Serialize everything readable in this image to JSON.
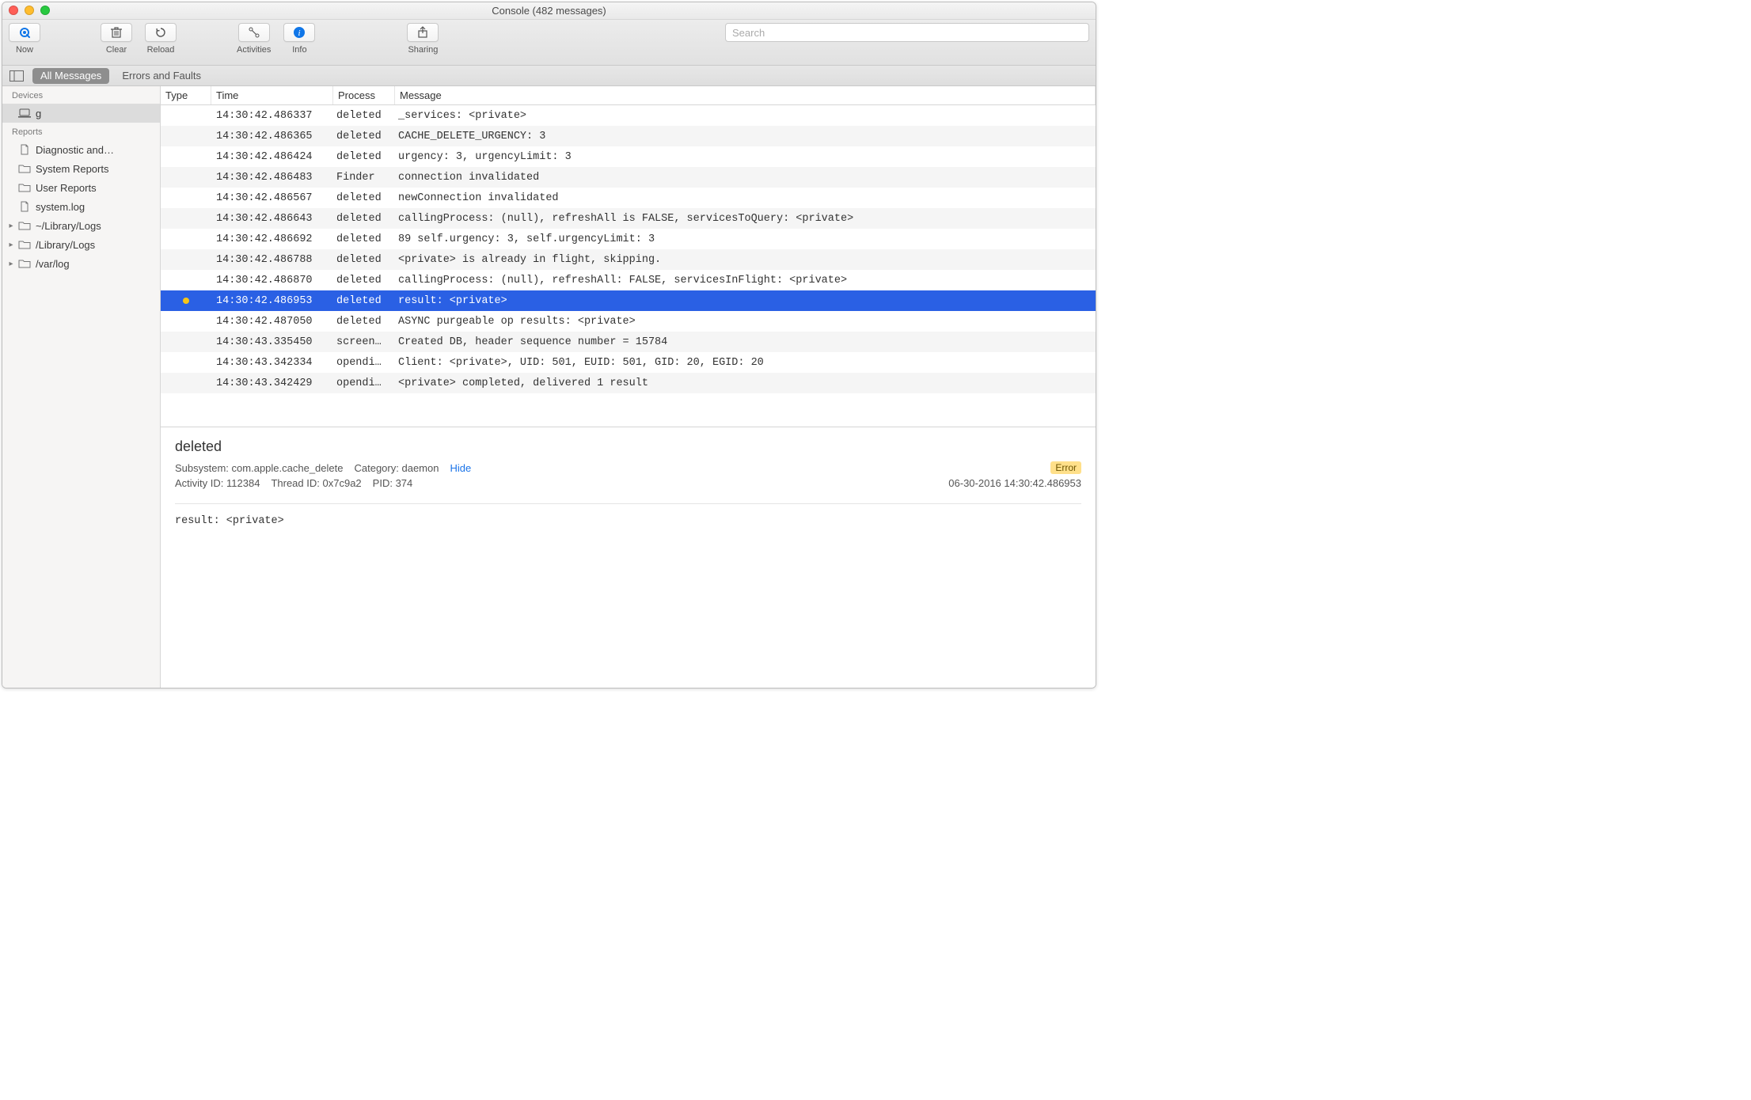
{
  "window": {
    "title": "Console (482 messages)"
  },
  "toolbar": {
    "now": "Now",
    "clear": "Clear",
    "reload": "Reload",
    "activities": "Activities",
    "info": "Info",
    "sharing": "Sharing",
    "search_placeholder": "Search"
  },
  "filterbar": {
    "all_messages": "All Messages",
    "errors_faults": "Errors and Faults"
  },
  "sidebar": {
    "devices_header": "Devices",
    "device_name": "g",
    "reports_header": "Reports",
    "reports": [
      {
        "label": "Diagnostic and…",
        "icon": "file",
        "disclosure": false
      },
      {
        "label": "System Reports",
        "icon": "folder",
        "disclosure": false
      },
      {
        "label": "User Reports",
        "icon": "folder",
        "disclosure": false
      },
      {
        "label": "system.log",
        "icon": "file",
        "disclosure": false
      },
      {
        "label": "~/Library/Logs",
        "icon": "folder",
        "disclosure": true
      },
      {
        "label": "/Library/Logs",
        "icon": "folder",
        "disclosure": true
      },
      {
        "label": "/var/log",
        "icon": "folder",
        "disclosure": true
      }
    ]
  },
  "table": {
    "headers": {
      "type": "Type",
      "time": "Time",
      "process": "Process",
      "message": "Message"
    },
    "rows": [
      {
        "dot": "",
        "time": "14:30:42.486337",
        "process": "deleted",
        "message": "_services: <private>",
        "selected": false
      },
      {
        "dot": "",
        "time": "14:30:42.486365",
        "process": "deleted",
        "message": "CACHE_DELETE_URGENCY: 3",
        "selected": false
      },
      {
        "dot": "",
        "time": "14:30:42.486424",
        "process": "deleted",
        "message": "urgency: 3, urgencyLimit: 3",
        "selected": false
      },
      {
        "dot": "",
        "time": "14:30:42.486483",
        "process": "Finder",
        "message": "connection invalidated",
        "selected": false
      },
      {
        "dot": "",
        "time": "14:30:42.486567",
        "process": "deleted",
        "message": "newConnection invalidated",
        "selected": false
      },
      {
        "dot": "",
        "time": "14:30:42.486643",
        "process": "deleted",
        "message": "callingProcess: (null), refreshAll is FALSE, servicesToQuery: <private>",
        "selected": false
      },
      {
        "dot": "",
        "time": "14:30:42.486692",
        "process": "deleted",
        "message": "89 self.urgency: 3, self.urgencyLimit: 3",
        "selected": false
      },
      {
        "dot": "",
        "time": "14:30:42.486788",
        "process": "deleted",
        "message": "<private> is already in flight, skipping.",
        "selected": false
      },
      {
        "dot": "",
        "time": "14:30:42.486870",
        "process": "deleted",
        "message": "callingProcess: (null), refreshAll: FALSE, servicesInFlight: <private>",
        "selected": false
      },
      {
        "dot": "yellow",
        "time": "14:30:42.486953",
        "process": "deleted",
        "message": "result: <private>",
        "selected": true
      },
      {
        "dot": "",
        "time": "14:30:42.487050",
        "process": "deleted",
        "message": "ASYNC purgeable op results: <private>",
        "selected": false
      },
      {
        "dot": "",
        "time": "14:30:43.335450",
        "process": "screen…",
        "message": "Created DB, header sequence number = 15784",
        "selected": false
      },
      {
        "dot": "",
        "time": "14:30:43.342334",
        "process": "opendi…",
        "message": "Client: <private>, UID: 501, EUID: 501, GID: 20, EGID: 20",
        "selected": false
      },
      {
        "dot": "",
        "time": "14:30:43.342429",
        "process": "opendi…",
        "message": "<private> completed, delivered 1 result",
        "selected": false
      }
    ]
  },
  "detail": {
    "process": "deleted",
    "subsystem_label": "Subsystem:",
    "subsystem": "com.apple.cache_delete",
    "category_label": "Category:",
    "category": "daemon",
    "hide": "Hide",
    "badge": "Error",
    "activity_label": "Activity ID:",
    "activity": "112384",
    "thread_label": "Thread ID:",
    "thread": "0x7c9a2",
    "pid_label": "PID:",
    "pid": "374",
    "timestamp": "06-30-2016 14:30:42.486953",
    "body": "result: <private>"
  }
}
